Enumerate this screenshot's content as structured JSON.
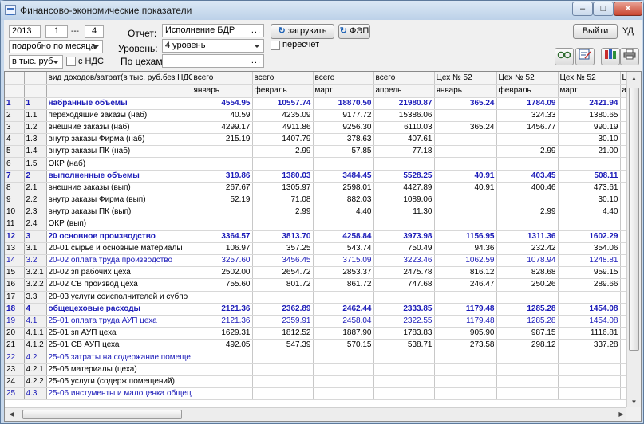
{
  "window": {
    "title": "Финансово-экономические показатели",
    "minimize": "–",
    "maximize": "□",
    "close": "✕"
  },
  "controls": {
    "year": "2013",
    "month_from": "1",
    "dash": "---",
    "month_to": "4",
    "period_mode": "подробно по месяца",
    "units": "в тыс. руб",
    "vat_label": "с НДС",
    "report_label": "Отчет:",
    "report_value": "Исполнение БДР",
    "level_label": "Уровень:",
    "level_value": "4 уровень",
    "workshops_label": "По цехам:",
    "workshops_value": "",
    "load_button": "загрузить",
    "fez_button": "ФЭП",
    "recalc_label": "пересчет",
    "exit_button": "Выйти",
    "ud_label": "УД",
    "ellipsis": "..."
  },
  "icons": [
    "glasses-icon",
    "edit-icon",
    "books-icon",
    "print-icon"
  ],
  "table": {
    "header1": [
      "",
      "",
      "вид доходов/затрат(в тыс. руб.без НДС)",
      "всего",
      "всего",
      "всего",
      "всего",
      "Цех № 52",
      "Цех № 52",
      "Цех № 52",
      "Ц"
    ],
    "header2": [
      "",
      "",
      "",
      "январь",
      "февраль",
      "март",
      "апрель",
      "январь",
      "февраль",
      "март",
      "а"
    ],
    "rows": [
      {
        "style": "b",
        "cells": [
          "1",
          "1",
          "набранные объемы",
          "4554.95",
          "10557.74",
          "18870.50",
          "21980.87",
          "365.24",
          "1784.09",
          "2421.94",
          ""
        ]
      },
      {
        "style": "",
        "cells": [
          "2",
          "1.1",
          "переходящие заказы (наб)",
          "40.59",
          "4235.09",
          "9177.72",
          "15386.06",
          "",
          "324.33",
          "1380.65",
          ""
        ]
      },
      {
        "style": "",
        "cells": [
          "3",
          "1.2",
          "внешние заказы (наб)",
          "4299.17",
          "4911.86",
          "9256.30",
          "6110.03",
          "365.24",
          "1456.77",
          "990.19",
          ""
        ]
      },
      {
        "style": "",
        "cells": [
          "4",
          "1.3",
          "внутр заказы Фирма (наб)",
          "215.19",
          "1407.79",
          "378.63",
          "407.61",
          "",
          "",
          "30.10",
          ""
        ]
      },
      {
        "style": "",
        "cells": [
          "5",
          "1.4",
          "внутр заказы ПК (наб)",
          "",
          "2.99",
          "57.85",
          "77.18",
          "",
          "2.99",
          "21.00",
          ""
        ]
      },
      {
        "style": "",
        "cells": [
          "6",
          "1.5",
          "ОКР (наб)",
          "",
          "",
          "",
          "",
          "",
          "",
          "",
          ""
        ]
      },
      {
        "style": "b",
        "cells": [
          "7",
          "2",
          "выполненные объемы",
          "319.86",
          "1380.03",
          "3484.45",
          "5528.25",
          "40.91",
          "403.45",
          "508.11",
          ""
        ]
      },
      {
        "style": "",
        "cells": [
          "8",
          "2.1",
          "внешние заказы (вып)",
          "267.67",
          "1305.97",
          "2598.01",
          "4427.89",
          "40.91",
          "400.46",
          "473.61",
          ""
        ]
      },
      {
        "style": "",
        "cells": [
          "9",
          "2.2",
          "внутр заказы Фирма (вып)",
          "52.19",
          "71.08",
          "882.03",
          "1089.06",
          "",
          "",
          "30.10",
          ""
        ]
      },
      {
        "style": "",
        "cells": [
          "10",
          "2.3",
          "внутр заказы ПК (вып)",
          "",
          "2.99",
          "4.40",
          "11.30",
          "",
          "2.99",
          "4.40",
          ""
        ]
      },
      {
        "style": "",
        "cells": [
          "11",
          "2.4",
          "ОКР (вып)",
          "",
          "",
          "",
          "",
          "",
          "",
          "",
          ""
        ]
      },
      {
        "style": "b",
        "cells": [
          "12",
          "3",
          "20 основное производство",
          "3364.57",
          "3813.70",
          "4258.84",
          "3973.98",
          "1156.95",
          "1311.36",
          "1602.29",
          ""
        ]
      },
      {
        "style": "",
        "cells": [
          "13",
          "3.1",
          "20-01 сырье и основные материалы",
          "106.97",
          "357.25",
          "543.74",
          "750.49",
          "94.36",
          "232.42",
          "354.06",
          ""
        ]
      },
      {
        "style": "i",
        "cells": [
          "14",
          "3.2",
          "20-02 оплата труда производство",
          "3257.60",
          "3456.45",
          "3715.09",
          "3223.46",
          "1062.59",
          "1078.94",
          "1248.81",
          ""
        ]
      },
      {
        "style": "",
        "cells": [
          "15",
          "3.2.1",
          "20-02 зп рабочих цеха",
          "2502.00",
          "2654.72",
          "2853.37",
          "2475.78",
          "816.12",
          "828.68",
          "959.15",
          ""
        ]
      },
      {
        "style": "",
        "cells": [
          "16",
          "3.2.2",
          "20-02 СВ производ цеха",
          "755.60",
          "801.72",
          "861.72",
          "747.68",
          "246.47",
          "250.26",
          "289.66",
          ""
        ]
      },
      {
        "style": "",
        "cells": [
          "17",
          "3.3",
          "20-03 услуги соисполнителей и субпо",
          "",
          "",
          "",
          "",
          "",
          "",
          "",
          ""
        ]
      },
      {
        "style": "b",
        "cells": [
          "18",
          "4",
          "общецеховые расходы",
          "2121.36",
          "2362.89",
          "2462.44",
          "2333.85",
          "1179.48",
          "1285.28",
          "1454.08",
          ""
        ]
      },
      {
        "style": "i",
        "cells": [
          "19",
          "4.1",
          "25-01 оплата труда АУП цеха",
          "2121.36",
          "2359.91",
          "2458.04",
          "2322.55",
          "1179.48",
          "1285.28",
          "1454.08",
          ""
        ]
      },
      {
        "style": "",
        "cells": [
          "20",
          "4.1.1",
          "25-01 зп АУП цеха",
          "1629.31",
          "1812.52",
          "1887.90",
          "1783.83",
          "905.90",
          "987.15",
          "1116.81",
          ""
        ]
      },
      {
        "style": "",
        "cells": [
          "21",
          "4.1.2",
          "25-01 СВ АУП цеха",
          "492.05",
          "547.39",
          "570.15",
          "538.71",
          "273.58",
          "298.12",
          "337.28",
          ""
        ]
      },
      {
        "style": "i",
        "cells": [
          "22",
          "4.2",
          "25-05 затраты на содержание помеще",
          "",
          "",
          "",
          "",
          "",
          "",
          "",
          ""
        ]
      },
      {
        "style": "",
        "cells": [
          "23",
          "4.2.1",
          "25-05 материалы (цеха)",
          "",
          "",
          "",
          "",
          "",
          "",
          "",
          ""
        ]
      },
      {
        "style": "",
        "cells": [
          "24",
          "4.2.2",
          "25-05 услуги (содерж помещений)",
          "",
          "",
          "",
          "",
          "",
          "",
          "",
          ""
        ]
      },
      {
        "style": "i",
        "cells": [
          "25",
          "4.3",
          "25-06 инстументы и малоценка общец",
          "",
          "",
          "",
          "",
          "",
          "",
          "",
          ""
        ]
      }
    ]
  }
}
